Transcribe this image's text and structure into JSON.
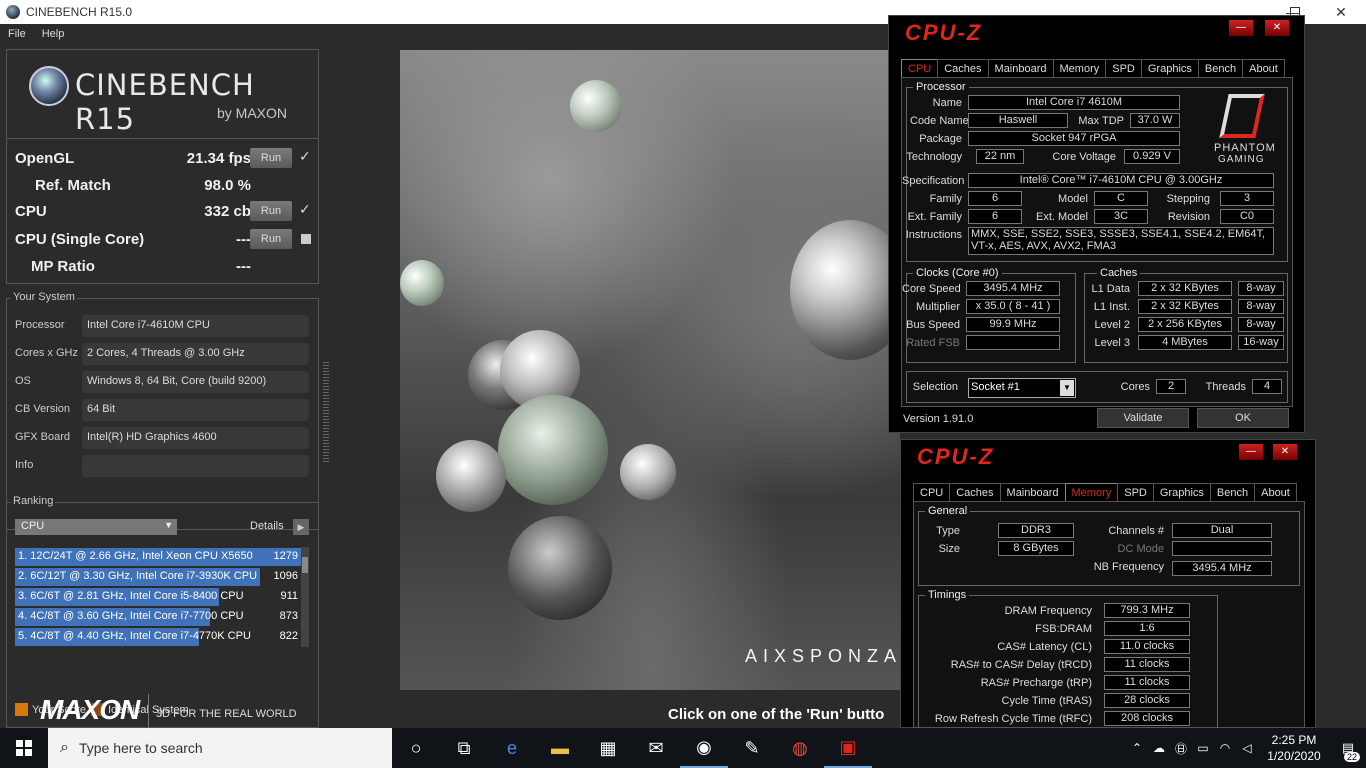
{
  "cinebench": {
    "window_title": "CINEBENCH R15.0",
    "menu": [
      "File",
      "Help"
    ],
    "logo_text": "CINEBENCH R15",
    "logo_sub": "by MAXON",
    "results": [
      {
        "label": "OpenGL",
        "value": "21.34 fps",
        "run": "Run",
        "mark": "✓"
      },
      {
        "label": "Ref. Match",
        "value": "98.0 %"
      },
      {
        "label": "CPU",
        "value": "332 cb",
        "run": "Run",
        "mark": "✓"
      },
      {
        "label": "CPU (Single Core)",
        "value": "---",
        "run": "Run"
      },
      {
        "label": "MP Ratio",
        "value": "---"
      }
    ],
    "your_system_title": "Your System",
    "system": [
      {
        "key": "Processor",
        "value": "Intel Core i7-4610M CPU"
      },
      {
        "key": "Cores x GHz",
        "value": "2 Cores, 4 Threads @ 3.00 GHz"
      },
      {
        "key": "OS",
        "value": "Windows 8, 64 Bit, Core (build 9200)"
      },
      {
        "key": "CB Version",
        "value": "64 Bit"
      },
      {
        "key": "GFX Board",
        "value": "Intel(R) HD Graphics 4600"
      },
      {
        "key": "Info",
        "value": ""
      }
    ],
    "ranking_title": "Ranking",
    "ranking_select": "CPU",
    "ranking_details": "Details",
    "ranking": [
      {
        "text": "1. 12C/24T @ 2.66 GHz, Intel Xeon CPU X5650",
        "score": "1279",
        "fill": 1.0
      },
      {
        "text": "2. 6C/12T @ 3.30 GHz,  Intel Core i7-3930K CPU",
        "score": "1096",
        "fill": 0.857
      },
      {
        "text": "3. 6C/6T @ 2.81 GHz, Intel Core i5-8400 CPU",
        "score": "911",
        "fill": 0.712
      },
      {
        "text": "4. 4C/8T @ 3.60 GHz, Intel Core i7-7700 CPU",
        "score": "873",
        "fill": 0.683
      },
      {
        "text": "5. 4C/8T @ 4.40 GHz, Intel Core i7-4770K CPU",
        "score": "822",
        "fill": 0.643
      }
    ],
    "legend_your_score": "Your Score",
    "legend_identical": "Identical System",
    "footer_brand": "MAXON",
    "footer_tag": "3D FOR THE REAL WORLD",
    "render_watermark": "AIXSPONZA",
    "status": "Click on one of the 'Run' butto",
    "colors": {
      "bar": "#3f72b8",
      "your_score": "#d7780c",
      "identical": "#8a4a10"
    }
  },
  "cpuz1": {
    "title": "CPU-Z",
    "tabs": [
      "CPU",
      "Caches",
      "Mainboard",
      "Memory",
      "SPD",
      "Graphics",
      "Bench",
      "About"
    ],
    "active_tab": "CPU",
    "processor_group": "Processor",
    "name_label": "Name",
    "name": "Intel Core i7 4610M",
    "code_label": "Code Name",
    "code": "Haswell",
    "tdp_label": "Max TDP",
    "tdp": "37.0 W",
    "package_label": "Package",
    "package": "Socket 947 rPGA",
    "tech_label": "Technology",
    "tech": "22 nm",
    "volt_label": "Core Voltage",
    "volt": "0.929 V",
    "spec_label": "Specification",
    "spec": "Intel® Core™ i7-4610M CPU @ 3.00GHz",
    "family_label": "Family",
    "family": "6",
    "model_label": "Model",
    "model": "C",
    "stepping_label": "Stepping",
    "stepping": "3",
    "extfam_label": "Ext. Family",
    "extfam": "6",
    "extmodel_label": "Ext. Model",
    "extmodel": "3C",
    "revision_label": "Revision",
    "revision": "C0",
    "instr_label": "Instructions",
    "instr": "MMX, SSE, SSE2, SSE3, SSSE3, SSE4.1, SSE4.2, EM64T, VT-x, AES, AVX, AVX2, FMA3",
    "clocks_group": "Clocks (Core #0)",
    "core_speed_label": "Core Speed",
    "core_speed": "3495.4 MHz",
    "mult_label": "Multiplier",
    "mult": "x 35.0 ( 8 - 41 )",
    "bus_label": "Bus Speed",
    "bus": "99.9 MHz",
    "fsb_label": "Rated FSB",
    "fsb": "",
    "caches_group": "Caches",
    "l1d_label": "L1 Data",
    "l1d": "2 x 32 KBytes",
    "l1d_way": "8-way",
    "l1i_label": "L1 Inst.",
    "l1i": "2 x 32 KBytes",
    "l1i_way": "8-way",
    "l2_label": "Level 2",
    "l2": "2 x 256 KBytes",
    "l2_way": "8-way",
    "l3_label": "Level 3",
    "l3": "4 MBytes",
    "l3_way": "16-way",
    "selection_label": "Selection",
    "selection": "Socket #1",
    "cores_label": "Cores",
    "cores": "2",
    "threads_label": "Threads",
    "threads": "4",
    "version": "Version 1.91.0",
    "validate": "Validate",
    "ok": "OK",
    "pg_line1": "PHANTOM",
    "pg_line2": "GAMING"
  },
  "cpuz2": {
    "title": "CPU-Z",
    "tabs": [
      "CPU",
      "Caches",
      "Mainboard",
      "Memory",
      "SPD",
      "Graphics",
      "Bench",
      "About"
    ],
    "active_tab": "Memory",
    "general_group": "General",
    "type_label": "Type",
    "type": "DDR3",
    "size_label": "Size",
    "size": "8 GBytes",
    "channels_label": "Channels #",
    "channels": "Dual",
    "dcmode_label": "DC Mode",
    "dcmode": "",
    "nbfreq_label": "NB Frequency",
    "nbfreq": "3495.4 MHz",
    "timings_group": "Timings",
    "timings": [
      {
        "label": "DRAM Frequency",
        "value": "799.3 MHz"
      },
      {
        "label": "FSB:DRAM",
        "value": "1:6"
      },
      {
        "label": "CAS# Latency (CL)",
        "value": "11.0 clocks"
      },
      {
        "label": "RAS# to CAS# Delay (tRCD)",
        "value": "11 clocks"
      },
      {
        "label": "RAS# Precharge (tRP)",
        "value": "11 clocks"
      },
      {
        "label": "Cycle Time (tRAS)",
        "value": "28 clocks"
      },
      {
        "label": "Row Refresh Cycle Time (tRFC)",
        "value": "208 clocks"
      }
    ]
  },
  "taskbar": {
    "search_placeholder": "Type here to search",
    "time": "2:25 PM",
    "date": "1/20/2020",
    "notifications": "22"
  }
}
